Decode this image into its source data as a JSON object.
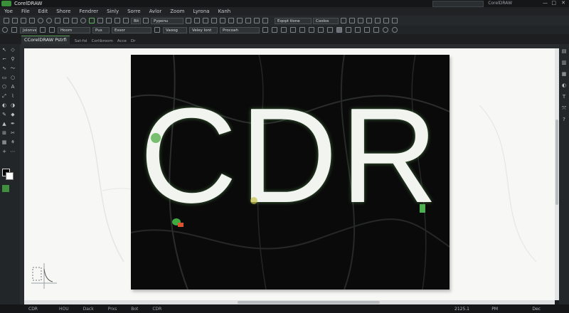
{
  "app": {
    "title": "CorelDRAW",
    "top_right_label": "CorelDRAW"
  },
  "menu": [
    "Yoe",
    "File",
    "Edit",
    "Shore",
    "Fendrer",
    "Sinly",
    "Sorre",
    "Avlor",
    "Zoom",
    "Lyrona",
    "Kanh"
  ],
  "toolbar": {
    "left_dropdown": "Bit",
    "right_dropdown": "Pypenu",
    "snap_dropdown": "Eqopt tlone",
    "zoom_dropdown": "Coolos"
  },
  "propbar": {
    "field1": "Jolonve",
    "field2": "Hoom",
    "field3": "Pus",
    "field4": "Essor",
    "field5": "Vaoog",
    "field6": "Veley Iont",
    "field7": "Procoah"
  },
  "tabs": {
    "active": "CCorelDRAW Pstrfi",
    "sub": [
      "Sat-fol",
      "Corlibroom",
      "Acce",
      "Dr"
    ]
  },
  "artwork": {
    "text": "CDR",
    "bg_color": "#0a0a0a"
  },
  "status": {
    "left": "CDR",
    "items": [
      "HOU",
      "Dack",
      "Prxs",
      "Bot",
      "CDR"
    ],
    "coords": "2125.1",
    "mode": "PM",
    "right": "Dec"
  },
  "colors": {
    "accent": "#4caf50",
    "canvas": "#f7f7f5",
    "dark": "#1b1d1f"
  }
}
